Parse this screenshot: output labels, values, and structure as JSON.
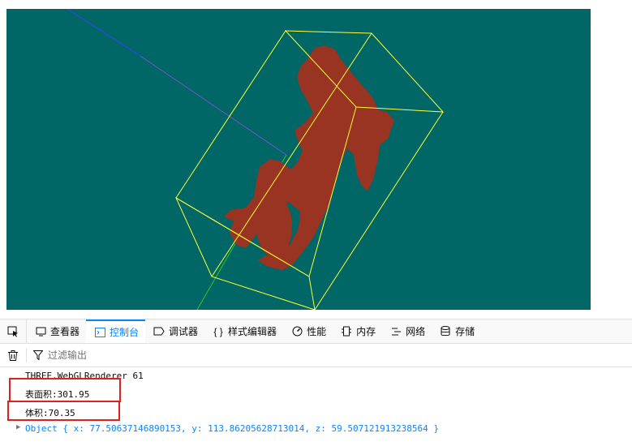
{
  "tabs": [
    {
      "label": "查看器",
      "icon": "inspector-icon"
    },
    {
      "label": "控制台",
      "icon": "console-icon",
      "active": true
    },
    {
      "label": "调试器",
      "icon": "debugger-icon"
    },
    {
      "label": "样式编辑器",
      "icon": "braces-icon"
    },
    {
      "label": "性能",
      "icon": "gauge-icon"
    },
    {
      "label": "内存",
      "icon": "memory-icon"
    },
    {
      "label": "网络",
      "icon": "network-icon"
    },
    {
      "label": "存储",
      "icon": "storage-icon"
    }
  ],
  "filter": {
    "placeholder": "过滤输出"
  },
  "console": {
    "renderer_line": "THREE.WebGLRenderer 61",
    "surface_area_line": "表面积:301.95",
    "volume_line": "体积:70.35",
    "object_line": "Object { x: 77.50637146890153, y: 113.86205628713014, z: 59.507121913238564 }"
  },
  "colors": {
    "canvas_bg": "#006666",
    "model_fill": "#993322",
    "bbox_line": "#ffff33",
    "highlight": "#e0201a",
    "accent": "#0a84ff"
  }
}
